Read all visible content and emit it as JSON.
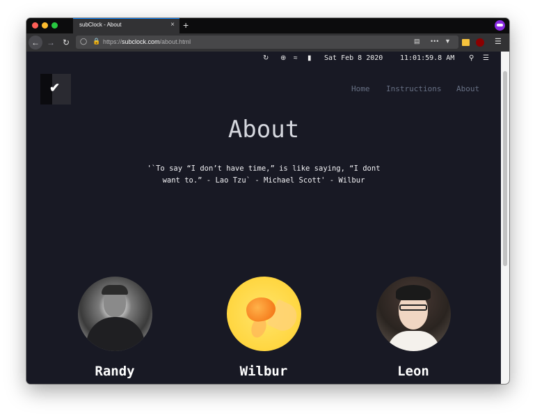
{
  "browser": {
    "tab_title": "subClock - About",
    "tab_close": "×",
    "new_tab": "+",
    "url_prefix": "https://",
    "url_domain": "subclock.com",
    "url_path": "/about.html",
    "more_glyph": "•••",
    "menu_glyph": "☰"
  },
  "menubar": {
    "date": "Sat Feb 8 2020",
    "time": "11:01:59.8 AM"
  },
  "site": {
    "nav": [
      "Home",
      "Instructions",
      "About"
    ],
    "title": "About",
    "quote": "'`To say “I don’t have time,” is like saying, “I dont want to.” - Lao Tzu` - Michael Scott' - Wilbur",
    "members": [
      {
        "name": "Randy"
      },
      {
        "name": "Wilbur"
      },
      {
        "name": "Leon"
      }
    ]
  }
}
